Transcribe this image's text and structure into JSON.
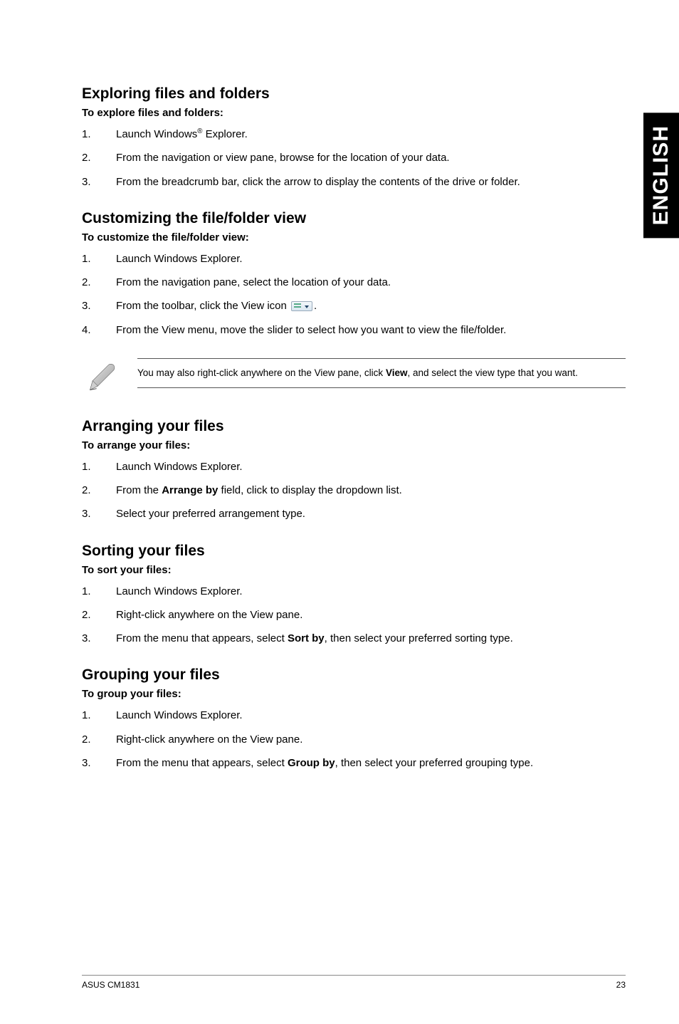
{
  "side_tab": "ENGLISH",
  "sections": {
    "exploring": {
      "heading": "Exploring files and folders",
      "subhead": "To explore files and folders:",
      "steps": [
        {
          "n": "1.",
          "pre": "Launch Windows",
          "sup": "®",
          "post": " Explorer."
        },
        {
          "n": "2.",
          "text": "From the navigation or view pane, browse for the location of your data."
        },
        {
          "n": "3.",
          "text": "From the breadcrumb bar, click the arrow to display the contents of the drive or folder."
        }
      ]
    },
    "customizing": {
      "heading": "Customizing the file/folder view",
      "subhead": "To customize the file/folder view:",
      "steps": [
        {
          "n": "1.",
          "text": "Launch Windows Explorer."
        },
        {
          "n": "2.",
          "text": "From the navigation pane, select the location of your data."
        },
        {
          "n": "3.",
          "pre": "From the toolbar, click the View icon ",
          "icon": true,
          "post": "."
        },
        {
          "n": "4.",
          "text": "From the View menu, move the slider to select how you want to view the file/folder."
        }
      ]
    },
    "note": {
      "pre": "You may also right-click anywhere on the View pane, click ",
      "bold": "View",
      "post": ", and select the view type that you want."
    },
    "arranging": {
      "heading": "Arranging your files",
      "subhead": "To arrange your files:",
      "steps": [
        {
          "n": "1.",
          "text": "Launch Windows Explorer."
        },
        {
          "n": "2.",
          "pre": "From the ",
          "bold": "Arrange by",
          "post": " field, click to display the dropdown list."
        },
        {
          "n": "3.",
          "text": "Select your preferred arrangement type."
        }
      ]
    },
    "sorting": {
      "heading": "Sorting your files",
      "subhead": "To sort your files:",
      "steps": [
        {
          "n": "1.",
          "text": "Launch Windows Explorer."
        },
        {
          "n": "2.",
          "text": "Right-click anywhere on the View pane."
        },
        {
          "n": "3.",
          "pre": "From the menu that appears, select ",
          "bold": "Sort by",
          "post": ", then select your preferred sorting type."
        }
      ]
    },
    "grouping": {
      "heading": "Grouping your files",
      "subhead": "To group your files:",
      "steps": [
        {
          "n": "1.",
          "text": "Launch Windows Explorer."
        },
        {
          "n": "2.",
          "text": "Right-click anywhere on the View pane."
        },
        {
          "n": "3.",
          "pre": "From the menu that appears, select ",
          "bold": "Group by",
          "post": ", then select your preferred grouping type."
        }
      ]
    }
  },
  "footer": {
    "left": "ASUS CM1831",
    "right": "23"
  }
}
